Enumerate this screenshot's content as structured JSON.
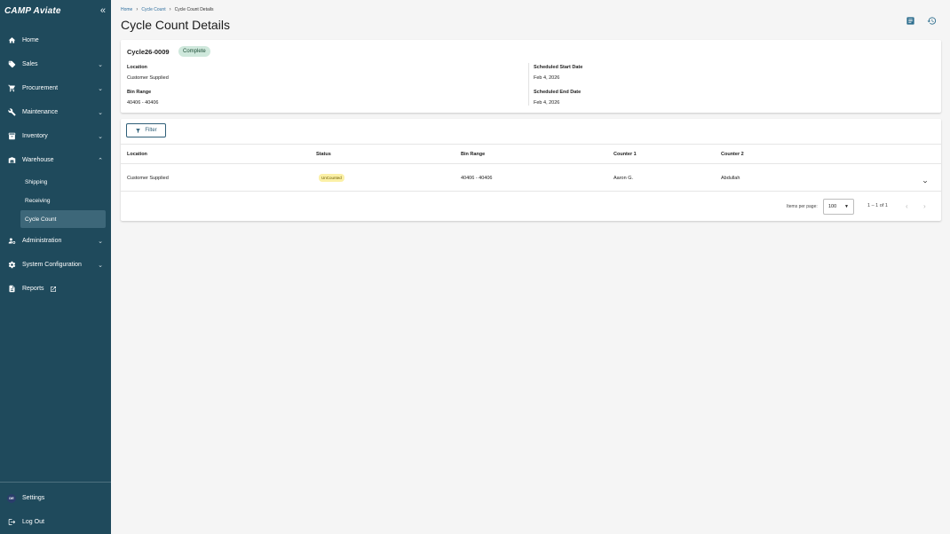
{
  "sidebar": {
    "logo": "CAMP Aviate",
    "items": [
      {
        "label": "Home",
        "icon": "home-icon"
      },
      {
        "label": "Sales",
        "icon": "tag-icon"
      },
      {
        "label": "Procurement",
        "icon": "cart-icon"
      },
      {
        "label": "Maintenance",
        "icon": "wrench-icon"
      },
      {
        "label": "Inventory",
        "icon": "inventory-icon"
      },
      {
        "label": "Warehouse",
        "icon": "warehouse-icon"
      },
      {
        "label": "Administration",
        "icon": "admin-icon"
      },
      {
        "label": "System Configuration",
        "icon": "gear-icon"
      },
      {
        "label": "Reports",
        "icon": "report-icon"
      }
    ],
    "warehouse_sub": [
      "Shipping",
      "Receiving",
      "Cycle Count"
    ],
    "active_sub": "Cycle Count",
    "footer": {
      "settings": "Settings",
      "logout": "Log Out",
      "avatar_initials": "DE"
    }
  },
  "breadcrumb": {
    "home": "Home",
    "section": "Cycle Count",
    "current": "Cycle Count Details"
  },
  "page_title": "Cycle Count Details",
  "header": {
    "cycle_id": "Cycle26-0009",
    "status": "Complete",
    "location_label": "Location",
    "location_value": "Customer Supplied",
    "bin_range_label": "Bin Range",
    "bin_range_value": "40406 - 40406",
    "start_label": "Scheduled Start Date",
    "start_value": "Feb 4, 2026",
    "end_label": "Scheduled End Date",
    "end_value": "Feb 4, 2026"
  },
  "table": {
    "filter_label": "Filter",
    "columns": [
      "Location",
      "Status",
      "Bin Range",
      "Counter 1",
      "Counter 2"
    ],
    "rows": [
      {
        "location": "Customer Supplied",
        "status": "UnCounted",
        "bin_range": "40406 - 40406",
        "counter1": "Aaron G.",
        "counter2": "Abdullah"
      }
    ],
    "pager": {
      "items_per_page_label": "Items per page:",
      "items_per_page": "100",
      "range": "1 – 1 of 1"
    }
  },
  "colors": {
    "sidebar": "#1f4a5c",
    "sidebar_active": "#3d6779",
    "badge_complete": "#cfe8dc",
    "chip_uncounted": "#fbf0a6",
    "accent": "#2f5f78"
  }
}
